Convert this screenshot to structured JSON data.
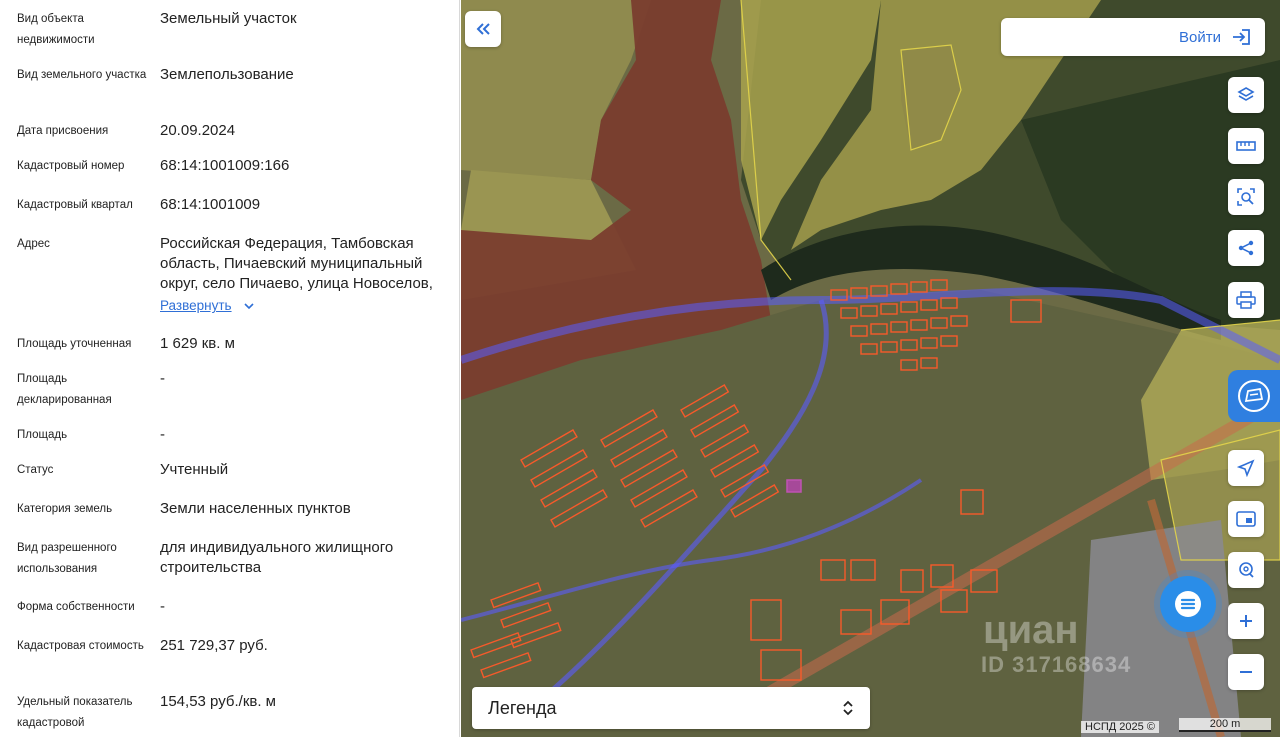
{
  "info_panel": {
    "rows": [
      {
        "label": "Вид объекта недвижимости",
        "value": "Земельный участок"
      },
      {
        "label": "Вид земельного участка",
        "value": "Землепользование"
      },
      {
        "label": "Дата присвоения",
        "value": "20.09.2024"
      },
      {
        "label": "Кадастровый номер",
        "value": "68:14:1001009:166"
      },
      {
        "label": "Кадастровый квартал",
        "value": "68:14:1001009"
      },
      {
        "label": "Адрес",
        "value": "Российская Федерация, Тамбовская область, Пичаевский муниципальный округ, село Пичаево, улица Новоселов,",
        "link": "Развернуть"
      },
      {
        "label": "Площадь уточненная",
        "value": "1 629 кв. м"
      },
      {
        "label": "Площадь декларированная",
        "value": "-"
      },
      {
        "label": "Площадь",
        "value": "-"
      },
      {
        "label": "Статус",
        "value": "Учтенный"
      },
      {
        "label": "Категория земель",
        "value": "Земли населенных пунктов"
      },
      {
        "label": "Вид разрешенного использования",
        "value": "для индивидуального жилищного строительства"
      },
      {
        "label": "Форма собственности",
        "value": "-"
      },
      {
        "label": "Кадастровая стоимость",
        "value": "251 729,37 руб."
      },
      {
        "label": "Удельный показатель кадастровой",
        "value": "154,53 руб./кв. м"
      }
    ]
  },
  "map": {
    "login_label": "Войти",
    "legend_label": "Легенда",
    "copyright": "НСПД 2025 ©",
    "scale_label": "200 m",
    "watermark_brand": "циан",
    "watermark_id": "ID 317168634",
    "tools": [
      "layers-icon",
      "ruler-icon",
      "area-search-icon",
      "share-icon",
      "print-icon",
      "complaint-icon",
      "geolocation-icon",
      "minimap-icon",
      "address-search-icon",
      "zoom-in-icon",
      "zoom-out-icon"
    ],
    "colors": {
      "accent": "#2f6fd6",
      "parcel": "#ff5a2a",
      "zone": "#e3b44a",
      "road": "#5a5cff",
      "selected": "#d63ad6"
    }
  }
}
